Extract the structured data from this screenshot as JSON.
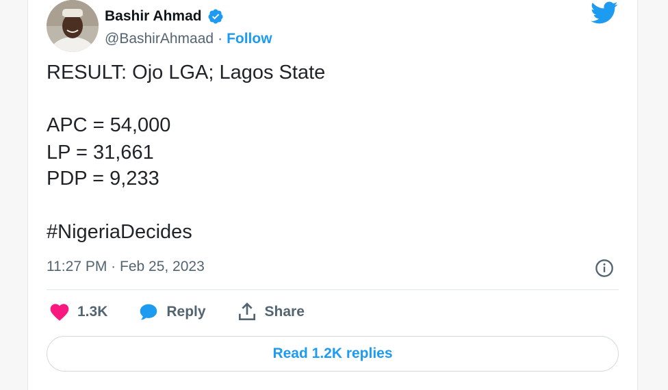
{
  "tweet": {
    "author_name": "Bashir Ahmad",
    "handle": "@BashirAhmaad",
    "separator": "·",
    "follow_label": "Follow",
    "text_lines": {
      "result": "RESULT: Ojo LGA; Lagos State",
      "apc": "APC = 54,000",
      "lp": "LP = 31,661",
      "pdp": "PDP = 9,233"
    },
    "hashtag": "#NigeriaDecides",
    "timestamp": "11:27 PM · Feb 25, 2023",
    "likes_count": "1.3K",
    "reply_label": "Reply",
    "share_label": "Share",
    "read_replies_label": "Read 1.2K replies"
  },
  "icons": {
    "verified": "verified-badge-icon",
    "logo": "twitter-bird-icon",
    "info": "info-icon",
    "like": "heart-icon",
    "reply": "speech-bubble-icon",
    "share": "share-upload-icon"
  },
  "colors": {
    "accent": "#1d9bf0",
    "like": "#f91880",
    "text": "#0f1419",
    "secondary": "#536471"
  }
}
